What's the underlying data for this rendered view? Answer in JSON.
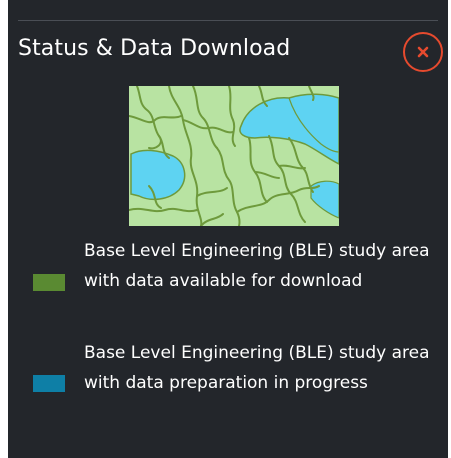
{
  "panel": {
    "title": "Status & Data Download",
    "close_icon": "close-x-icon",
    "accent_color": "#e64a2e",
    "background_color": "#23262b"
  },
  "preview": {
    "icon": "ble-study-area-map-thumbnail"
  },
  "legend": {
    "items": [
      {
        "label": "Base Level Engineering (BLE) study area with data available for download",
        "color": "#5a8a32"
      },
      {
        "label": "Base Level Engineering (BLE) study area with data preparation in progress",
        "color": "#0e7fa6"
      }
    ]
  }
}
